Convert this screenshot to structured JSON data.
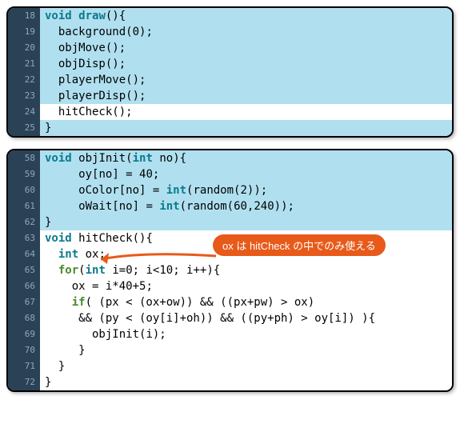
{
  "block1": {
    "lines": [
      {
        "n": "18",
        "hl": "blue",
        "tokens": [
          {
            "t": "void ",
            "c": "kw-type"
          },
          {
            "t": "draw",
            "c": "kw-funcdef"
          },
          {
            "t": "(){",
            "c": "punct"
          }
        ]
      },
      {
        "n": "19",
        "hl": "blue",
        "tokens": [
          {
            "t": "  background",
            "c": "fn"
          },
          {
            "t": "(",
            "c": "punct"
          },
          {
            "t": "0",
            "c": "num"
          },
          {
            "t": ");",
            "c": "punct"
          }
        ]
      },
      {
        "n": "20",
        "hl": "blue",
        "tokens": [
          {
            "t": "  objMove",
            "c": "fn"
          },
          {
            "t": "();",
            "c": "punct"
          }
        ]
      },
      {
        "n": "21",
        "hl": "blue",
        "tokens": [
          {
            "t": "  objDisp",
            "c": "fn"
          },
          {
            "t": "();",
            "c": "punct"
          }
        ]
      },
      {
        "n": "22",
        "hl": "blue",
        "tokens": [
          {
            "t": "  playerMove",
            "c": "fn"
          },
          {
            "t": "();",
            "c": "punct"
          }
        ]
      },
      {
        "n": "23",
        "hl": "blue",
        "tokens": [
          {
            "t": "  playerDisp",
            "c": "fn"
          },
          {
            "t": "();",
            "c": "punct"
          }
        ]
      },
      {
        "n": "24",
        "hl": "white",
        "tokens": [
          {
            "t": "  hitCheck",
            "c": "fn"
          },
          {
            "t": "();",
            "c": "punct"
          }
        ]
      },
      {
        "n": "25",
        "hl": "blue",
        "tokens": [
          {
            "t": "}",
            "c": "punct"
          }
        ]
      }
    ]
  },
  "block2": {
    "lines": [
      {
        "n": "58",
        "hl": "blue",
        "tokens": [
          {
            "t": "void ",
            "c": "kw-type"
          },
          {
            "t": "objInit",
            "c": "fn"
          },
          {
            "t": "(",
            "c": "punct"
          },
          {
            "t": "int ",
            "c": "kw-type"
          },
          {
            "t": "no",
            "c": "fn"
          },
          {
            "t": "){",
            "c": "punct"
          }
        ]
      },
      {
        "n": "59",
        "hl": "blue",
        "tokens": [
          {
            "t": "     oy",
            "c": "fn"
          },
          {
            "t": "[",
            "c": "punct"
          },
          {
            "t": "no",
            "c": "fn"
          },
          {
            "t": "] = ",
            "c": "punct"
          },
          {
            "t": "40",
            "c": "num"
          },
          {
            "t": ";",
            "c": "punct"
          }
        ]
      },
      {
        "n": "60",
        "hl": "blue",
        "tokens": [
          {
            "t": "     oColor",
            "c": "fn"
          },
          {
            "t": "[",
            "c": "punct"
          },
          {
            "t": "no",
            "c": "fn"
          },
          {
            "t": "] = ",
            "c": "punct"
          },
          {
            "t": "int",
            "c": "kw-type"
          },
          {
            "t": "(",
            "c": "punct"
          },
          {
            "t": "random",
            "c": "fn"
          },
          {
            "t": "(",
            "c": "punct"
          },
          {
            "t": "2",
            "c": "num"
          },
          {
            "t": "));",
            "c": "punct"
          }
        ]
      },
      {
        "n": "61",
        "hl": "blue",
        "tokens": [
          {
            "t": "     oWait",
            "c": "fn"
          },
          {
            "t": "[",
            "c": "punct"
          },
          {
            "t": "no",
            "c": "fn"
          },
          {
            "t": "] = ",
            "c": "punct"
          },
          {
            "t": "int",
            "c": "kw-type"
          },
          {
            "t": "(",
            "c": "punct"
          },
          {
            "t": "random",
            "c": "fn"
          },
          {
            "t": "(",
            "c": "punct"
          },
          {
            "t": "60",
            "c": "num"
          },
          {
            "t": ",",
            "c": "punct"
          },
          {
            "t": "240",
            "c": "num"
          },
          {
            "t": "));",
            "c": "punct"
          }
        ]
      },
      {
        "n": "62",
        "hl": "blue",
        "tokens": [
          {
            "t": "}",
            "c": "punct"
          }
        ]
      },
      {
        "n": "63",
        "hl": "white",
        "tokens": [
          {
            "t": "void ",
            "c": "kw-type"
          },
          {
            "t": "hitCheck",
            "c": "fn"
          },
          {
            "t": "(){",
            "c": "punct"
          }
        ]
      },
      {
        "n": "64",
        "hl": "white",
        "tokens": [
          {
            "t": "  ",
            "c": "punct"
          },
          {
            "t": "int ",
            "c": "kw-type"
          },
          {
            "t": "ox",
            "c": "fn"
          },
          {
            "t": ";",
            "c": "punct"
          }
        ]
      },
      {
        "n": "65",
        "hl": "white",
        "tokens": [
          {
            "t": "  ",
            "c": "punct"
          },
          {
            "t": "for",
            "c": "kw-ctrl"
          },
          {
            "t": "(",
            "c": "punct"
          },
          {
            "t": "int ",
            "c": "kw-type"
          },
          {
            "t": "i",
            "c": "fn"
          },
          {
            "t": "=",
            "c": "punct"
          },
          {
            "t": "0",
            "c": "num"
          },
          {
            "t": "; i<",
            "c": "punct"
          },
          {
            "t": "10",
            "c": "num"
          },
          {
            "t": "; i",
            "c": "punct"
          },
          {
            "t": "++",
            "c": "punct"
          },
          {
            "t": "){",
            "c": "punct"
          }
        ]
      },
      {
        "n": "66",
        "hl": "white",
        "tokens": [
          {
            "t": "    ox ",
            "c": "fn"
          },
          {
            "t": "= i*",
            "c": "punct"
          },
          {
            "t": "40",
            "c": "num"
          },
          {
            "t": "+",
            "c": "punct"
          },
          {
            "t": "5",
            "c": "num"
          },
          {
            "t": ";",
            "c": "punct"
          }
        ]
      },
      {
        "n": "67",
        "hl": "white",
        "tokens": [
          {
            "t": "    ",
            "c": "punct"
          },
          {
            "t": "if",
            "c": "kw-ctrl"
          },
          {
            "t": "( (px < (ox+ow)) && ((px+pw) > ox)",
            "c": "punct"
          }
        ]
      },
      {
        "n": "68",
        "hl": "white",
        "tokens": [
          {
            "t": "     && (py < (oy[i]+oh)) && ((py+ph) > oy[i]) ){",
            "c": "punct"
          }
        ]
      },
      {
        "n": "69",
        "hl": "white",
        "tokens": [
          {
            "t": "       objInit",
            "c": "fn"
          },
          {
            "t": "(i);",
            "c": "punct"
          }
        ]
      },
      {
        "n": "70",
        "hl": "white",
        "tokens": [
          {
            "t": "     }",
            "c": "punct"
          }
        ]
      },
      {
        "n": "71",
        "hl": "white",
        "tokens": [
          {
            "t": "  }",
            "c": "punct"
          }
        ]
      },
      {
        "n": "72",
        "hl": "white",
        "tokens": [
          {
            "t": "}",
            "c": "punct"
          }
        ]
      }
    ]
  },
  "callout": {
    "text": "ox は hitCheck の中でのみ使える"
  }
}
